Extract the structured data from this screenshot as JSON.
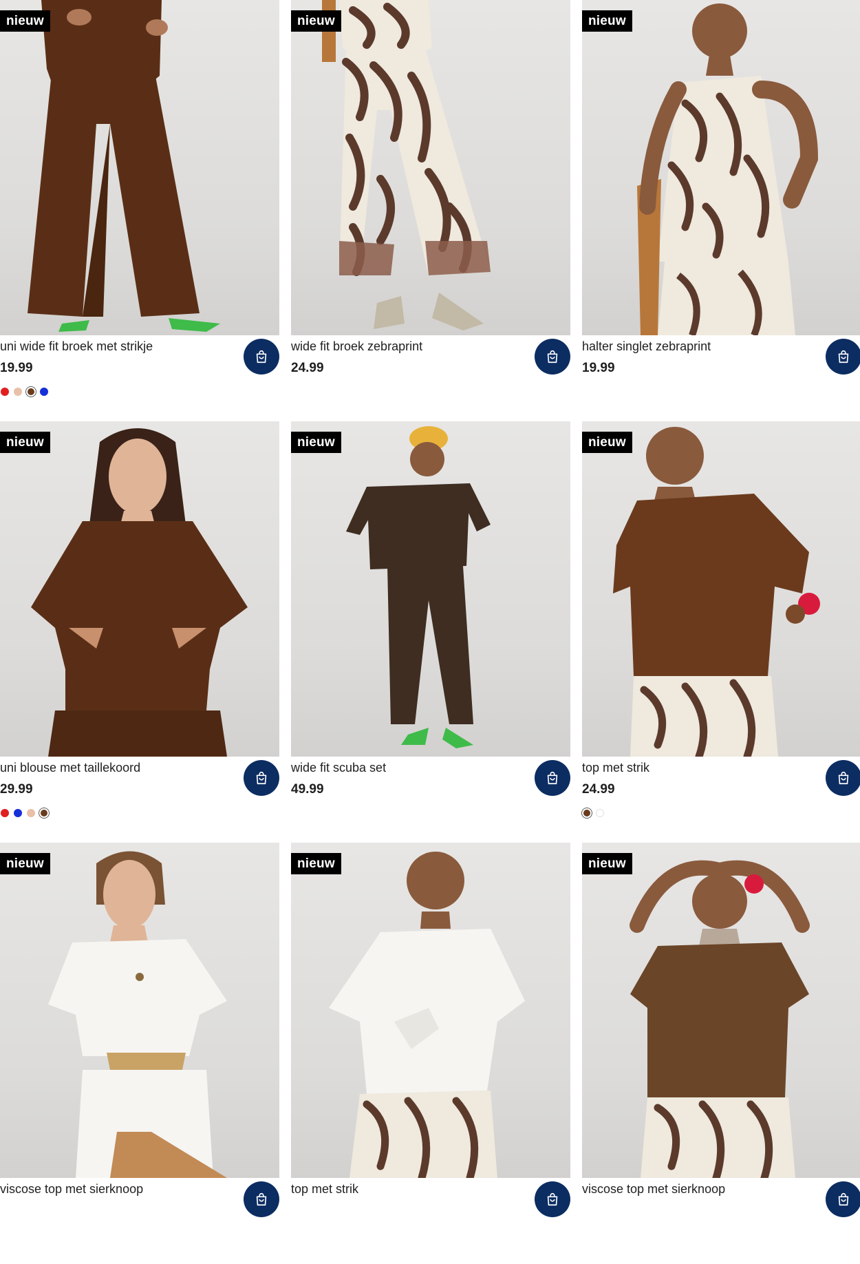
{
  "badge_label": "nieuw",
  "colors": {
    "cart_button": "#0c2d62",
    "brown": "#5a2e16",
    "dark_brown": "#3f2d22",
    "zebra_dark": "#5b3a2c",
    "zebra_light": "#efe9de"
  },
  "products": [
    {
      "name": "uni wide fit broek met strikje",
      "price": "19.99",
      "badge": "nieuw",
      "icon": "cart-icon",
      "swatches": [
        {
          "color": "#e02020",
          "selected": false
        },
        {
          "color": "#e9c0a8",
          "selected": false
        },
        {
          "color": "#6a3b1c",
          "selected": true
        },
        {
          "color": "#1530d8",
          "selected": false
        }
      ]
    },
    {
      "name": "wide fit broek zebraprint",
      "price": "24.99",
      "badge": "nieuw",
      "icon": "cart-icon",
      "swatches": []
    },
    {
      "name": "halter singlet zebraprint",
      "price": "19.99",
      "badge": "nieuw",
      "icon": "cart-icon",
      "swatches": []
    },
    {
      "name": "uni blouse met taillekoord",
      "price": "29.99",
      "badge": "nieuw",
      "icon": "cart-icon",
      "swatches": [
        {
          "color": "#e02020",
          "selected": false
        },
        {
          "color": "#1530d8",
          "selected": false
        },
        {
          "color": "#e9c0a8",
          "selected": false
        },
        {
          "color": "#6a3b1c",
          "selected": true
        }
      ]
    },
    {
      "name": "wide fit scuba set",
      "price": "49.99",
      "badge": "nieuw",
      "icon": "cart-icon",
      "swatches": []
    },
    {
      "name": "top met strik",
      "price": "24.99",
      "badge": "nieuw",
      "icon": "cart-icon",
      "swatches": [
        {
          "color": "#6a3b1c",
          "selected": true
        },
        {
          "color": "#ffffff",
          "selected": false
        }
      ]
    },
    {
      "name": "viscose top met sierknoop",
      "price": "",
      "badge": "nieuw",
      "icon": "cart-icon",
      "swatches": []
    },
    {
      "name": "top met strik",
      "price": "",
      "badge": "nieuw",
      "icon": "cart-icon",
      "swatches": []
    },
    {
      "name": "viscose top met sierknoop",
      "price": "",
      "badge": "nieuw",
      "icon": "cart-icon",
      "swatches": []
    }
  ]
}
